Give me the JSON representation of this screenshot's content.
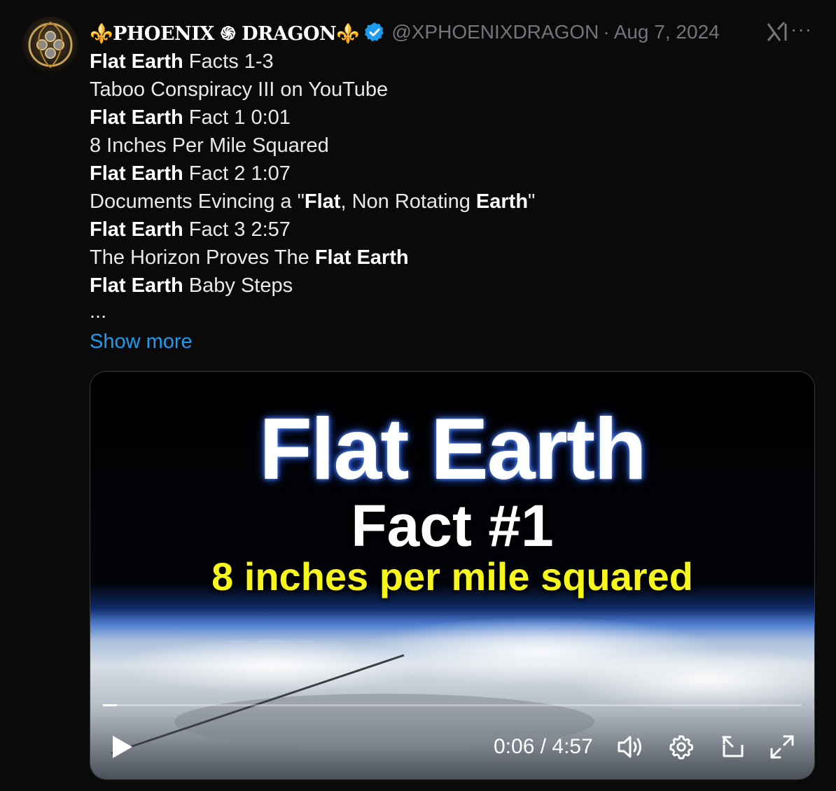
{
  "post": {
    "display_name": "⚜️PHOENIX ֍ DRAGON⚜️",
    "handle": "@XPHOENIXDRAGON",
    "separator": "·",
    "date": "Aug 7, 2024",
    "more": "···",
    "lines": [
      [
        {
          "t": "Flat Earth",
          "b": true
        },
        {
          "t": " Facts 1-3"
        }
      ],
      [
        {
          "t": "Taboo Conspiracy III on YouTube"
        }
      ],
      [
        {
          "t": "Flat Earth",
          "b": true
        },
        {
          "t": " Fact 1   0:01"
        }
      ],
      [
        {
          "t": "8 Inches Per Mile Squared"
        }
      ],
      [
        {
          "t": "Flat Earth",
          "b": true
        },
        {
          "t": " Fact 2   1:07"
        }
      ],
      [
        {
          "t": "Documents Evincing a \""
        },
        {
          "t": "Flat",
          "b": true
        },
        {
          "t": ", Non Rotating "
        },
        {
          "t": "Earth",
          "b": true
        },
        {
          "t": "\""
        }
      ],
      [
        {
          "t": "Flat Earth",
          "b": true
        },
        {
          "t": " Fact 3   2:57"
        }
      ],
      [
        {
          "t": "The Horizon Proves The "
        },
        {
          "t": "Flat Earth",
          "b": true
        }
      ],
      [
        {
          "t": "Flat Earth",
          "b": true
        },
        {
          "t": " Baby Steps"
        }
      ]
    ],
    "ellipsis": "...",
    "show_more": "Show more"
  },
  "video": {
    "title": "Flat Earth",
    "subtitle": "Fact #1",
    "caption": "8 inches per mile squared",
    "time": "0:06 / 4:57",
    "progress": 0.02
  },
  "colors": {
    "background": "#0a0a0a",
    "link": "#1d9bf0",
    "verified": "#1d9bf0",
    "muted": "#71767b",
    "caption_yellow": "#f6f61c"
  }
}
